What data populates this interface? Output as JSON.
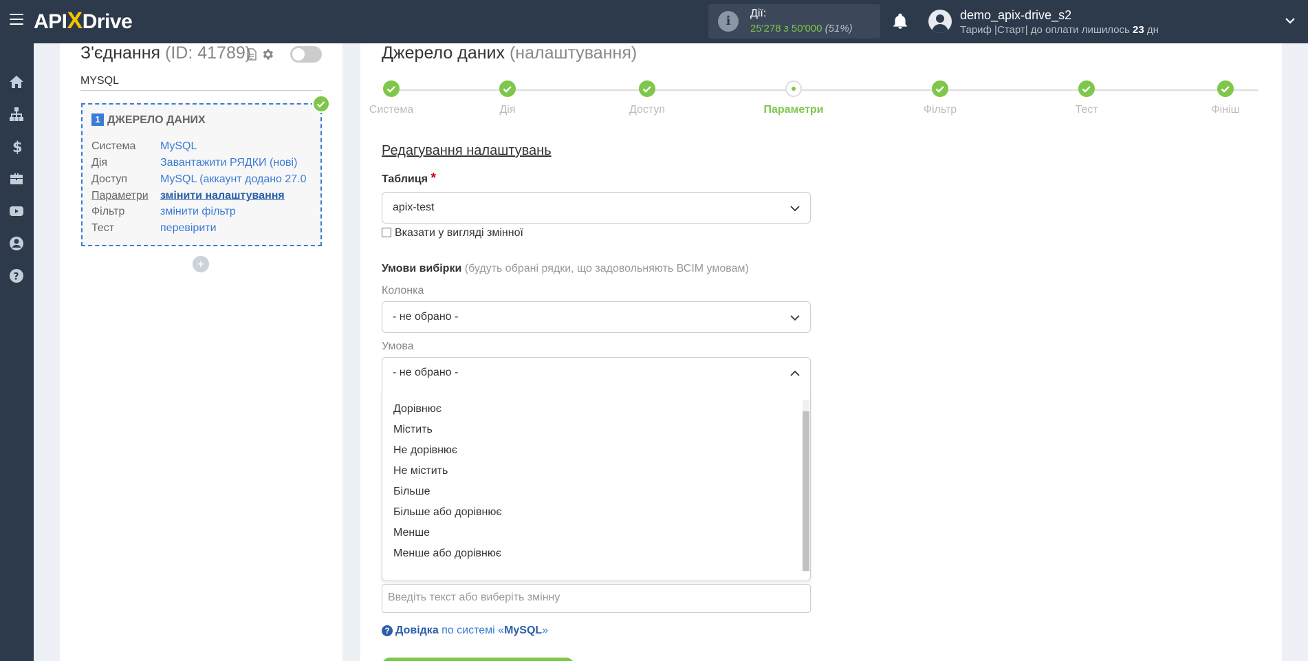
{
  "header": {
    "logo": {
      "api": "API",
      "x": "X",
      "drive": "Drive"
    },
    "actions": {
      "label": "Дії:",
      "count": "25'278",
      "of": "з",
      "limit": "50'000",
      "percent": "(51%)"
    },
    "user": {
      "name": "demo_apix-drive_s2",
      "tariff_prefix": "Тариф |Старт| до оплати лишилось",
      "days": "23",
      "days_unit": "дн"
    }
  },
  "leftnav": {
    "items": [
      "home-icon",
      "sitemap-icon",
      "dollar-icon",
      "briefcase-icon",
      "youtube-icon",
      "user-icon",
      "help-icon"
    ]
  },
  "connection": {
    "title": "З'єднання",
    "id": "(ID: 41789)",
    "name": "MYSQL",
    "source": {
      "number": "1",
      "title": "ДЖЕРЕЛО ДАНИХ",
      "rows": [
        {
          "key": "Система",
          "value": "MySQL"
        },
        {
          "key": "Дія",
          "value": "Завантажити РЯДКИ (нові)"
        },
        {
          "key": "Доступ",
          "value": "MySQL (аккаунт додано 27.0"
        },
        {
          "key": "Параметри",
          "value": "змінити налаштування"
        },
        {
          "key": "Фільтр",
          "value": "змінити фільтр"
        },
        {
          "key": "Тест",
          "value": "перевірити"
        }
      ]
    },
    "add_label": "+"
  },
  "main": {
    "title": "Джерело даних",
    "subtitle": "(налаштування)",
    "steps": [
      {
        "label": "Система",
        "state": "done"
      },
      {
        "label": "Дія",
        "state": "done"
      },
      {
        "label": "Доступ",
        "state": "done"
      },
      {
        "label": "Параметри",
        "state": "current"
      },
      {
        "label": "Фільтр",
        "state": "done"
      },
      {
        "label": "Тест",
        "state": "done"
      },
      {
        "label": "Фініш",
        "state": "done"
      }
    ],
    "section_title": "Редагування налаштувань",
    "table_label": "Таблиця",
    "table_required": "*",
    "table_value": "apix-test",
    "variable_checkbox": "Вказати у вигляді змінної",
    "conditions_label": "Умови вибірки",
    "conditions_hint": "(будуть обрані рядки, що задовольняють ВСІМ умовам)",
    "column_label": "Колонка",
    "column_value": "- не обрано -",
    "condition_label": "Умова",
    "condition_value": "- не обрано -",
    "condition_options": [
      "Дорівнює",
      "Містить",
      "Не дорівнює",
      "Не містить",
      "Більше",
      "Більше або дорівнює",
      "Менше",
      "Менше або дорівнює"
    ],
    "value_placeholder": "Введіть текст або виберіть змінну",
    "help_link": "Довідка",
    "help_mid": "по системі «",
    "help_system": "MySQL",
    "help_end": "»"
  },
  "colors": {
    "topbar": "#2d3a4b",
    "accent_green": "#7ec74a",
    "accent_blue": "#3a7bd5"
  }
}
